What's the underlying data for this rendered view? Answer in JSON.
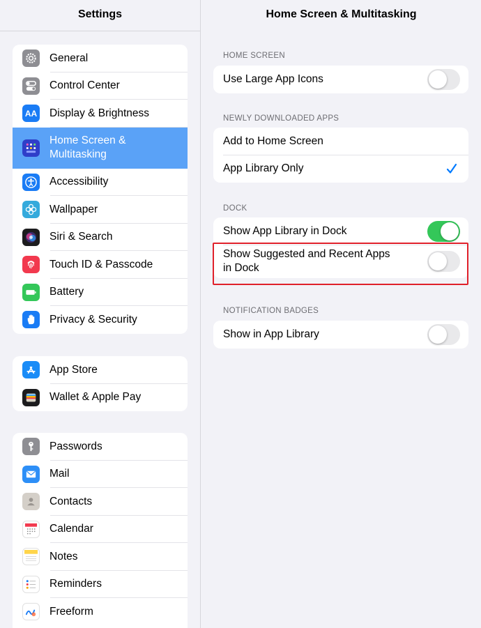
{
  "sidebar": {
    "title": "Settings",
    "groups": [
      {
        "items": [
          {
            "label": "General",
            "icon": "gear-icon",
            "color": "#8e8e93"
          },
          {
            "label": "Control Center",
            "icon": "switches-icon",
            "color": "#8e8e93"
          },
          {
            "label": "Display & Brightness",
            "icon": "text-size-icon",
            "color": "#1a7cf5"
          },
          {
            "label": "Home Screen & Multitasking",
            "icon": "grid-icon",
            "color": "#2f3ec9",
            "selected": true
          },
          {
            "label": "Accessibility",
            "icon": "accessibility-icon",
            "color": "#1a7cf5"
          },
          {
            "label": "Wallpaper",
            "icon": "flower-icon",
            "color": "#35aadc"
          },
          {
            "label": "Siri & Search",
            "icon": "siri-icon",
            "color": "#222"
          },
          {
            "label": "Touch ID & Passcode",
            "icon": "fingerprint-icon",
            "color": "#f2394e"
          },
          {
            "label": "Battery",
            "icon": "battery-icon",
            "color": "#34c759"
          },
          {
            "label": "Privacy & Security",
            "icon": "hand-icon",
            "color": "#1a7cf5"
          }
        ]
      },
      {
        "items": [
          {
            "label": "App Store",
            "icon": "app-store-icon",
            "color": "#1a8cf7"
          },
          {
            "label": "Wallet & Apple Pay",
            "icon": "wallet-icon",
            "color": "#1c1c1e"
          }
        ]
      },
      {
        "items": [
          {
            "label": "Passwords",
            "icon": "key-icon",
            "color": "#8e8e93"
          },
          {
            "label": "Mail",
            "icon": "mail-icon",
            "color": "#2d8ff7"
          },
          {
            "label": "Contacts",
            "icon": "contacts-icon",
            "color": "#c9c4bd"
          },
          {
            "label": "Calendar",
            "icon": "calendar-icon",
            "color": "#ffffff"
          },
          {
            "label": "Notes",
            "icon": "notes-icon",
            "color": "#ffd54a"
          },
          {
            "label": "Reminders",
            "icon": "reminders-icon",
            "color": "#ffffff"
          },
          {
            "label": "Freeform",
            "icon": "freeform-icon",
            "color": "#ffffff"
          }
        ]
      }
    ]
  },
  "detail": {
    "title": "Home Screen & Multitasking",
    "sections": [
      {
        "header": "HOME SCREEN",
        "rows": [
          {
            "label": "Use Large App Icons",
            "toggle": false
          }
        ]
      },
      {
        "header": "NEWLY DOWNLOADED APPS",
        "rows": [
          {
            "label": "Add to Home Screen",
            "checked": false
          },
          {
            "label": "App Library Only",
            "checked": true
          }
        ]
      },
      {
        "header": "DOCK",
        "rows": [
          {
            "label": "Show App Library in Dock",
            "toggle": true
          },
          {
            "label": "Show Suggested and Recent Apps in Dock",
            "toggle": false
          }
        ]
      },
      {
        "header": "NOTIFICATION BADGES",
        "rows": [
          {
            "label": "Show in App Library",
            "toggle": false
          }
        ]
      }
    ]
  },
  "colors": {
    "accent": "#007aff",
    "selection": "#5aa2f7",
    "toggle_on": "#34c759",
    "highlight": "#e0202a"
  }
}
